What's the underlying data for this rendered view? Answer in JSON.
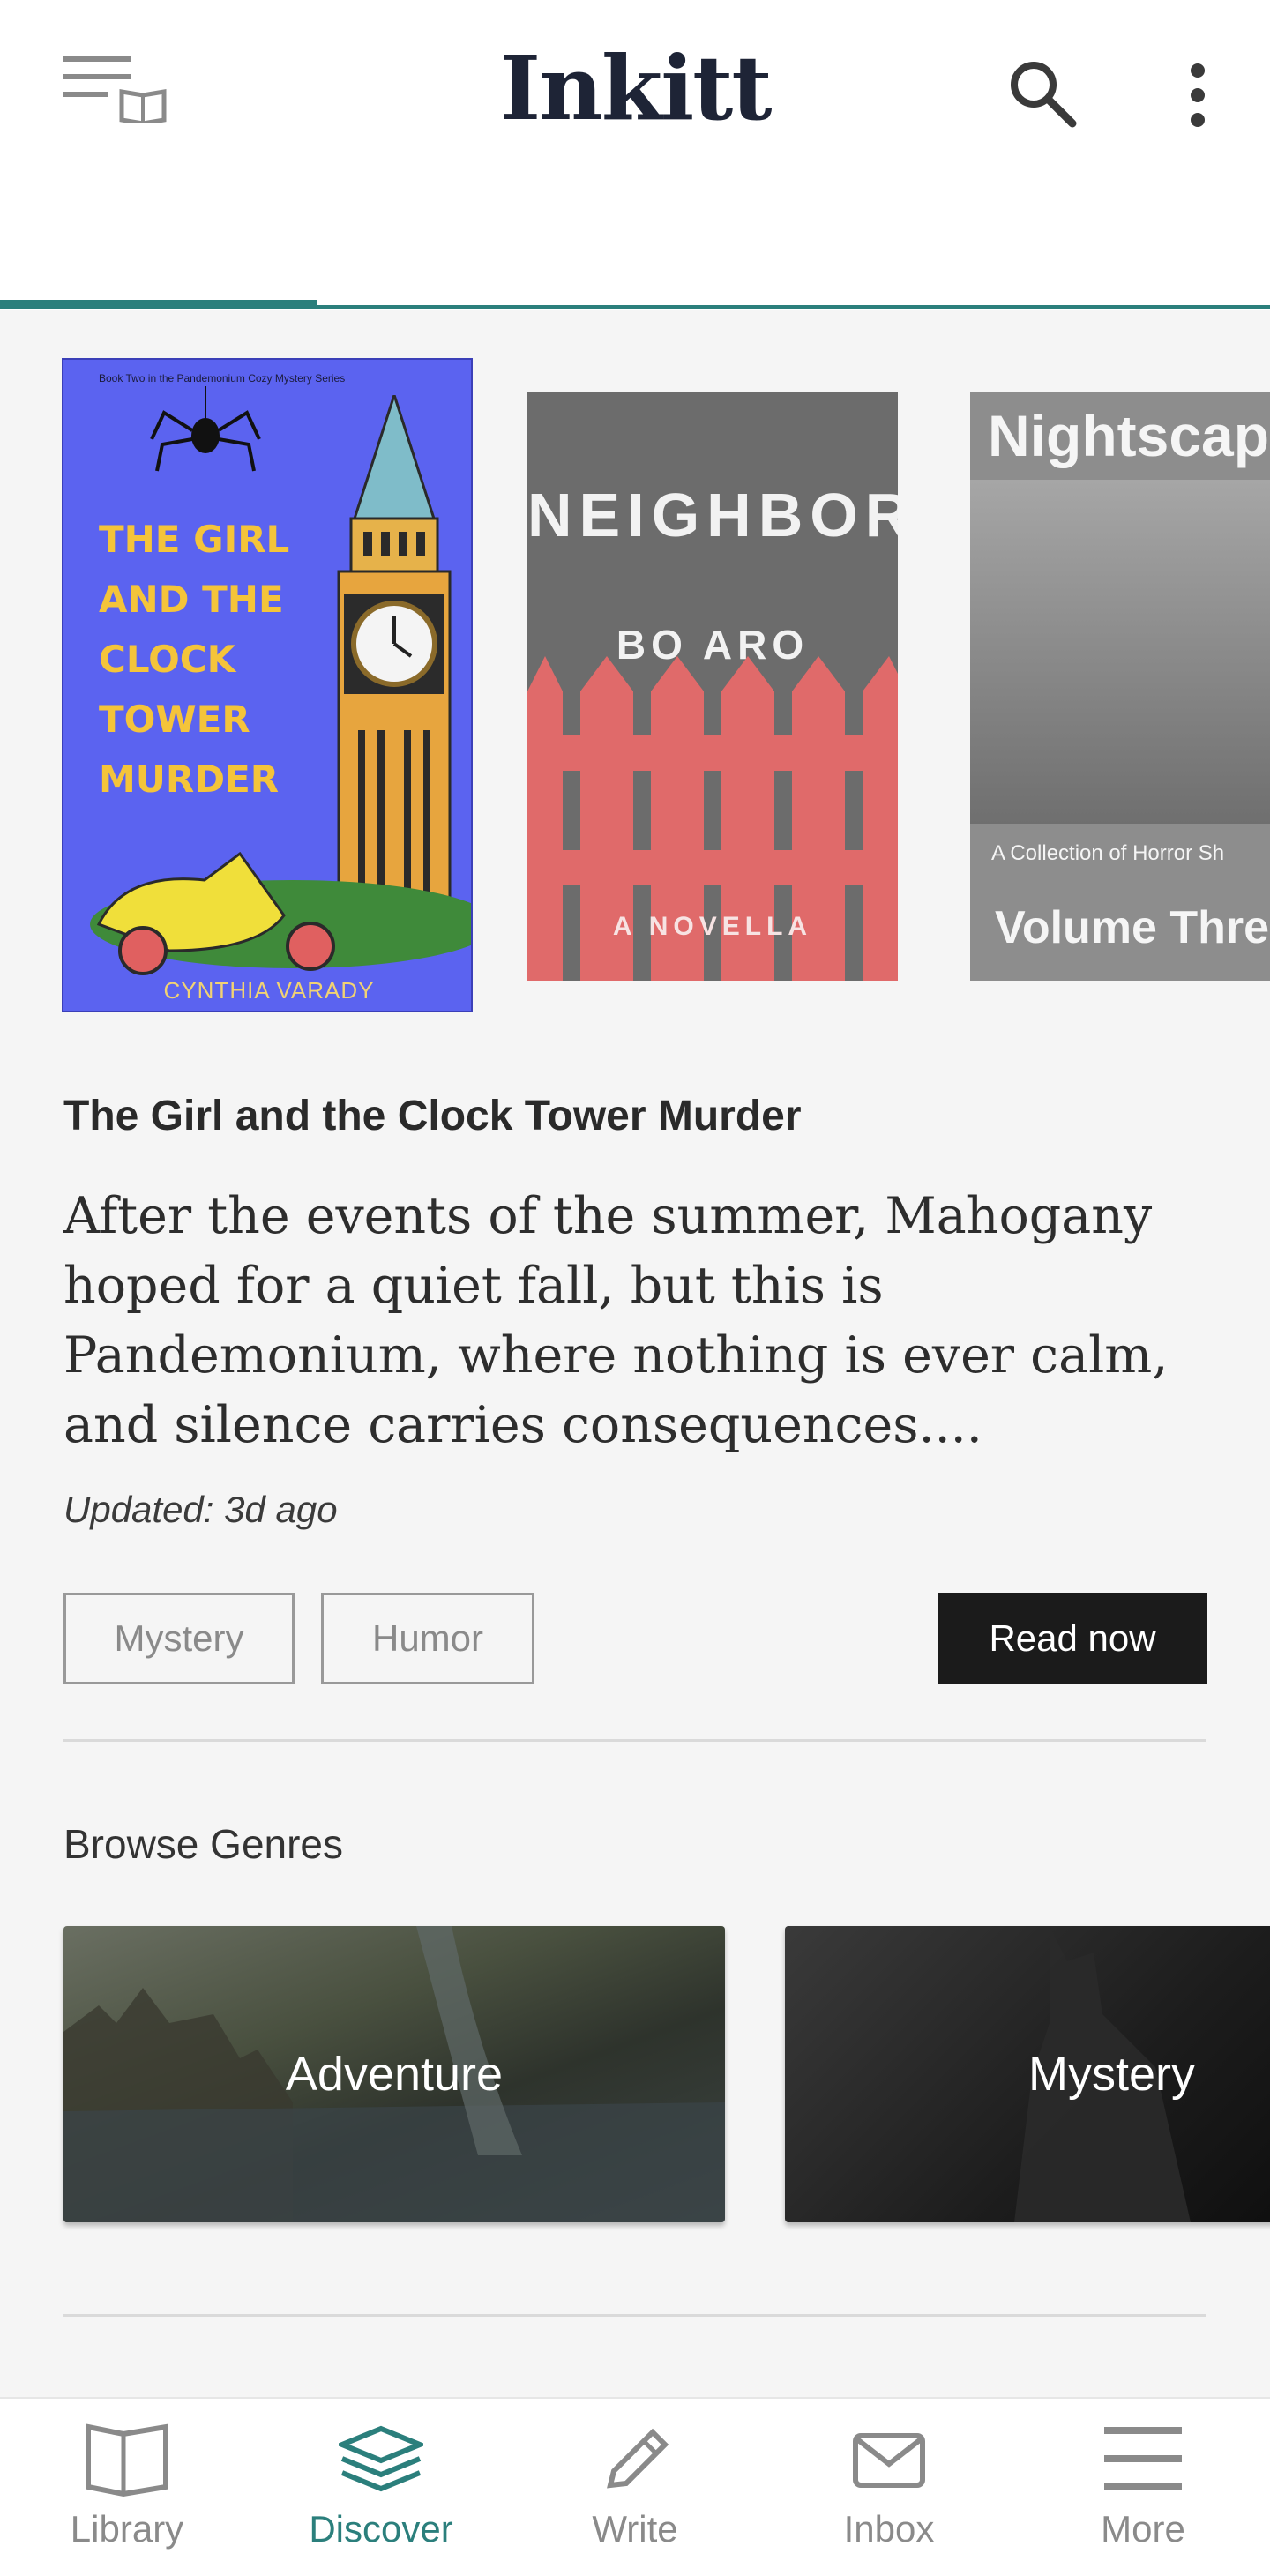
{
  "app": {
    "logo_text": "Inkitt"
  },
  "colors": {
    "accent": "#2b7f7c",
    "button_dark": "#1b1b1b"
  },
  "header": {
    "icons": [
      "menu-list-book-icon",
      "search-icon",
      "more-vertical-icon"
    ]
  },
  "featured_covers": [
    {
      "top_line": "Book Two in the Pandemonium Cozy Mystery Series",
      "title_lines": [
        "THE GIRL",
        "AND THE",
        "CLOCK",
        "TOWER",
        "MURDER"
      ],
      "author": "CYNTHIA VARADY"
    },
    {
      "title": "NEIGHBOR",
      "author": "BO ARO",
      "footer": "A NOVELLA"
    },
    {
      "title": "Nightscap",
      "subtitle": "A Collection of Horror Sh",
      "volume": "Volume Thre"
    }
  ],
  "featured": {
    "title": "The Girl and the Clock Tower Murder",
    "description": "After the events of the summer, Mahogany hoped for a quiet fall, but this is Pandemonium, where nothing is ever calm, and silence carries consequences....",
    "updated": "Updated: 3d ago",
    "tags": [
      "Mystery",
      "Humor"
    ],
    "cta": "Read now"
  },
  "genres": {
    "heading": "Browse Genres",
    "items": [
      "Adventure",
      "Mystery"
    ]
  },
  "bottom_nav": {
    "active": "Discover",
    "items": [
      {
        "label": "Library",
        "icon": "book-icon"
      },
      {
        "label": "Discover",
        "icon": "stack-icon"
      },
      {
        "label": "Write",
        "icon": "pencil-icon"
      },
      {
        "label": "Inbox",
        "icon": "envelope-icon"
      },
      {
        "label": "More",
        "icon": "hamburger-icon"
      }
    ]
  }
}
